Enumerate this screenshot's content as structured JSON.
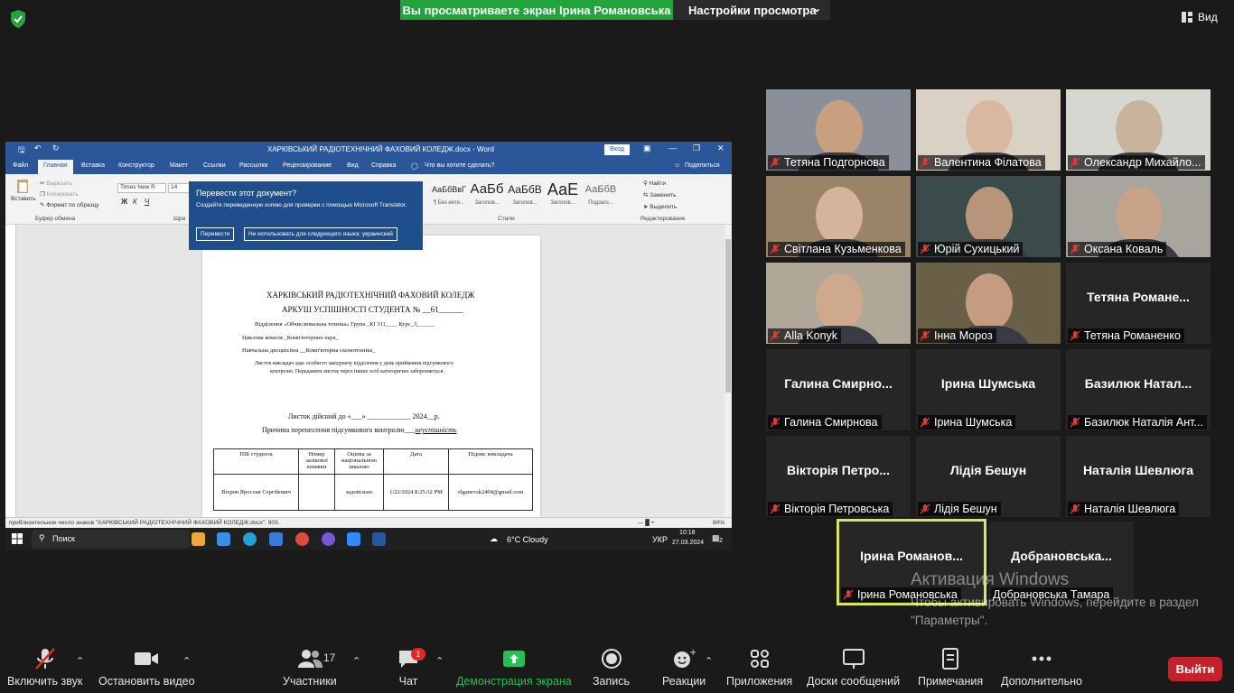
{
  "top_bar": {
    "share_banner": "Вы просматриваете экран Ірина Романовська",
    "view_settings": "Настройки просмотра",
    "view_button": "Вид"
  },
  "shared_screen": {
    "window_title": "ХАРКІВСЬКИЙ РАДІОТЕХНІЧНИЙ ФАХОВИЙ КОЛЕДЖ.docx - Word",
    "login_button": "Вход",
    "tabs": [
      "Файл",
      "Главная",
      "Вставка",
      "Конструктор",
      "Макет",
      "Ссылки",
      "Рассылки",
      "Рецензирование",
      "Вид",
      "Справка",
      "Что вы хотите сделать?",
      "Поделиться"
    ],
    "ribbon": {
      "paste": "Вставить",
      "cut": "Вырезать",
      "copy": "Копировать",
      "format_painter": "Формат по образцу",
      "clipboard_group": "Буфер обмена",
      "font_name": "Times New R",
      "font_size": "14",
      "font_group": "Шри",
      "styles_group": "Стили",
      "editing_group": "Редактирование",
      "find": "Найти",
      "replace": "Заменить",
      "select": "Выделить",
      "styles": [
        {
          "preview": "АаБбВвГ",
          "label": "¶ Без инте..."
        },
        {
          "preview": "АаБб",
          "label": "Заголов..."
        },
        {
          "preview": "АаБбВ",
          "label": "Заголов..."
        },
        {
          "preview": "АаЕ",
          "label": "Заголов..."
        },
        {
          "preview": "АаБбВ",
          "label": "Подзаго..."
        }
      ]
    },
    "translate_popup": {
      "title": "Перевести этот документ?",
      "description": "Создайте переведенную копию для проверки с помощью Microsoft Translator.",
      "translate_btn": "Перевести",
      "skip_btn": "Не использовать для следующего языка: украинский"
    },
    "document": {
      "line1": "ХАРКІВСЬКИЙ РАДІОТЕХНІЧНИЙ  ФАХОВИЙ КОЛЕДЖ",
      "line2": "АРКУШ УСПІШНОСТІ СТУДЕНТА № __61______",
      "line3": "Відділення «Обчислювальна техніка» Група _КІ 311____   Курс_3______",
      "line4": "Циклова комісія _Комп'ютерних наук_",
      "line5": "Навчальна дисципліна __Комп'ютерна схемотехніка_",
      "line6": "Листок  викладач здає особисто завідувачу відділення у день приймання підсумкового",
      "line7": "контролю. Передавати листок через інших осіб категорично забороняється.",
      "line8": "Листок дійсний до «___» ____________ 2024__р.",
      "line9_prefix": "Причина перенесення підсумкового контролю___",
      "line9_value": "неуспішність",
      "table_headers": [
        "ПІБ студента",
        "Номер залікової книжки",
        "Оцінка за національною шкалою",
        "Дата",
        "Підпис викладача"
      ],
      "table_row": [
        "Віхров Ярослав Сергійович",
        "",
        "задовільно",
        "1/22/2024 8:25:32 PM",
        "olganevsk2404@gmail.com"
      ]
    },
    "status_bar": "приблизительное число знаков \"ХАРКІВСЬКИЙ РАДІОТЕХНІЧНИЙ  ФАХОВИЙ КОЛЕДЖ.docx\": 903.",
    "zoom": "80%",
    "taskbar": {
      "search": "Поиск",
      "weather": "6°C  Cloudy",
      "lang": "УКР",
      "time": "10:18",
      "date": "27.03.2024",
      "notifications": "2"
    }
  },
  "participants": [
    {
      "name": "Тетяна Подгорнова",
      "video": true
    },
    {
      "name": "Валентина Філатова",
      "video": true
    },
    {
      "name": "Олександр Михайло...",
      "video": true
    },
    {
      "name": "Світлана Кузьменкова",
      "video": true
    },
    {
      "name": "Юрій Сухицький",
      "video": true
    },
    {
      "name": "Оксана Коваль",
      "video": true
    },
    {
      "name": "Alla Konyk",
      "video": true
    },
    {
      "name": "Інна Мороз",
      "video": true
    },
    {
      "name": "Тетяна Романенко",
      "big": "Тетяна  Романе...",
      "video": false
    },
    {
      "name": "Галина Смирнова",
      "big": "Галина  Смирно...",
      "video": false
    },
    {
      "name": "Ірина Шумська",
      "big": "Ірина Шумська",
      "video": false
    },
    {
      "name": "Базилюк Наталія Ант...",
      "big": "Базилюк  Натал...",
      "video": false
    },
    {
      "name": "Вікторія Петровська",
      "big": "Вікторія  Петро...",
      "video": false
    },
    {
      "name": "Лідія Бешун",
      "big": "Лідія Бешун",
      "video": false
    },
    {
      "name": "Наталія Шевлюга",
      "big": "Наталія Шевлюга",
      "video": false
    },
    {
      "name": "Ірина Романовська",
      "big": "Ірина  Романов...",
      "video": false,
      "active": true
    },
    {
      "name": "Добрановська Тамара",
      "big": "Добрановська...",
      "video": false
    }
  ],
  "watermark": {
    "title": "Активация Windows",
    "text": "Чтобы активировать Windows, перейдите в раздел \"Параметры\"."
  },
  "toolbar": {
    "unmute": "Включить звук",
    "stop_video": "Остановить видео",
    "participants": "Участники",
    "participants_count": "17",
    "chat": "Чат",
    "chat_badge": "1",
    "share": "Демонстрация экрана",
    "record": "Запись",
    "reactions": "Реакции",
    "apps": "Приложения",
    "whiteboards": "Доски сообщений",
    "notes": "Примечания",
    "more": "Дополнительно",
    "leave": "Выйти"
  },
  "colors": {
    "share_green": "#23a33b",
    "leave_red": "#c4222a",
    "active_speaker": "#d7e65a",
    "word_blue": "#2b579a",
    "share_icon_green": "#22c055"
  }
}
